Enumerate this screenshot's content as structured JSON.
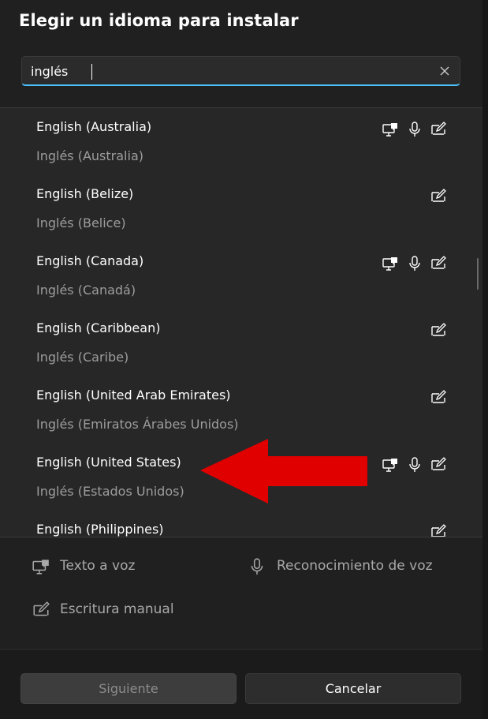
{
  "dialog": {
    "title": "Elegir un idioma para instalar"
  },
  "search": {
    "value": "inglés",
    "clear_icon": "close-icon"
  },
  "languages": [
    {
      "name": "English (Australia)",
      "native": "Inglés (Australia)",
      "features": [
        "text-to-speech-icon",
        "microphone-icon",
        "handwriting-icon"
      ]
    },
    {
      "name": "English (Belize)",
      "native": "Inglés (Belice)",
      "features": [
        "handwriting-icon"
      ]
    },
    {
      "name": "English (Canada)",
      "native": "Inglés (Canadá)",
      "features": [
        "text-to-speech-icon",
        "microphone-icon",
        "handwriting-icon"
      ]
    },
    {
      "name": "English (Caribbean)",
      "native": "Inglés (Caribe)",
      "features": [
        "handwriting-icon"
      ]
    },
    {
      "name": "English (United Arab Emirates)",
      "native": "Inglés (Emiratos Árabes Unidos)",
      "features": [
        "handwriting-icon"
      ]
    },
    {
      "name": "English (United States)",
      "native": "Inglés (Estados Unidos)",
      "features": [
        "text-to-speech-icon",
        "microphone-icon",
        "handwriting-icon"
      ]
    },
    {
      "name": "English (Philippines)",
      "native": "",
      "features": [
        "handwriting-icon"
      ]
    }
  ],
  "legend": {
    "tts": "Texto a voz",
    "speech": "Reconocimiento de voz",
    "handwriting": "Escritura manual"
  },
  "buttons": {
    "next": "Siguiente",
    "cancel": "Cancelar"
  },
  "colors": {
    "accent": "#4cc2ff",
    "annotation_arrow": "#e00000"
  }
}
